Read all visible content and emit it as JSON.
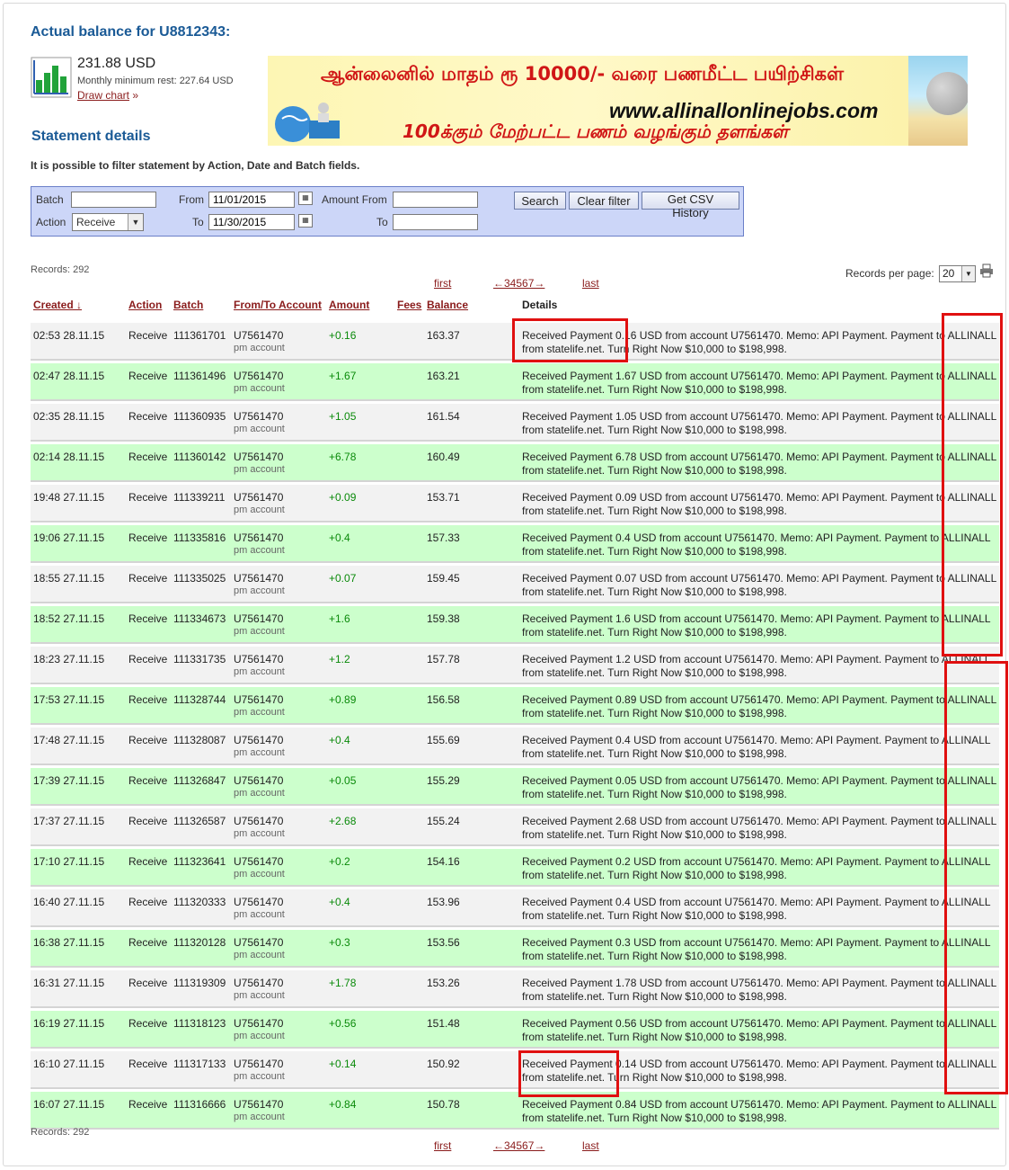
{
  "header": {
    "title": "Actual balance for U8812343:",
    "balance": "231.88 USD",
    "monthly_min": "Monthly minimum rest: 227.64 USD",
    "draw_chart": "Draw chart",
    "draw_chart_suffix": "»"
  },
  "banner": {
    "line1": "ஆன்லைனில் மாதம் ரூ 10000/- வரை பணமீட்ட பயிற்சிகள்",
    "line2": "www.allinallonlinejobs.com",
    "line3": "100க்கும் மேற்பட்ட பணம் வழங்கும் தளங்கள்"
  },
  "statement": {
    "title": "Statement details",
    "note": "It is possible to filter statement by Action, Date and Batch fields."
  },
  "filter": {
    "batch_label": "Batch",
    "action_label": "Action",
    "action_value": "Receive",
    "from_label": "From",
    "from_value": "11/01/2015",
    "to_label": "To",
    "to_value": "11/30/2015",
    "amount_from_label": "Amount From",
    "amount_to_label": "To",
    "search_btn": "Search",
    "clear_btn": "Clear filter",
    "csv_btn": "Get CSV History"
  },
  "records_label": "Records: 292",
  "pager": {
    "first": "first",
    "pages": "←34567→",
    "last": "last"
  },
  "records_per_page": {
    "label": "Records per page:",
    "value": "20"
  },
  "columns": {
    "created": "Created ↓",
    "action": "Action",
    "batch": "Batch",
    "account": "From/To Account",
    "amount": "Amount",
    "fees": "Fees",
    "balance": "Balance",
    "details": "Details"
  },
  "rows": [
    {
      "created": "02:53 28.11.15",
      "action": "Receive",
      "batch": "111361701",
      "account": "U7561470",
      "acct_type": "pm account",
      "amount": "+0.16",
      "balance": "163.37",
      "d1": "Received Payment 0.16 USD from account U7561470. Memo: API Payment. Payment to ALLINALL",
      "d2": "from statelife.net. Turn Right Now $10,000 to $198,998."
    },
    {
      "created": "02:47 28.11.15",
      "action": "Receive",
      "batch": "111361496",
      "account": "U7561470",
      "acct_type": "pm account",
      "amount": "+1.67",
      "balance": "163.21",
      "d1": "Received Payment 1.67 USD from account U7561470. Memo: API Payment. Payment to ALLINALL",
      "d2": "from statelife.net. Turn Right Now $10,000 to $198,998."
    },
    {
      "created": "02:35 28.11.15",
      "action": "Receive",
      "batch": "111360935",
      "account": "U7561470",
      "acct_type": "pm account",
      "amount": "+1.05",
      "balance": "161.54",
      "d1": "Received Payment 1.05 USD from account U7561470. Memo: API Payment. Payment to ALLINALL",
      "d2": "from statelife.net. Turn Right Now $10,000 to $198,998."
    },
    {
      "created": "02:14 28.11.15",
      "action": "Receive",
      "batch": "111360142",
      "account": "U7561470",
      "acct_type": "pm account",
      "amount": "+6.78",
      "balance": "160.49",
      "d1": "Received Payment 6.78 USD from account U7561470. Memo: API Payment. Payment to ALLINALL",
      "d2": "from statelife.net. Turn Right Now $10,000 to $198,998."
    },
    {
      "created": "19:48 27.11.15",
      "action": "Receive",
      "batch": "111339211",
      "account": "U7561470",
      "acct_type": "pm account",
      "amount": "+0.09",
      "balance": "153.71",
      "d1": "Received Payment 0.09 USD from account U7561470. Memo: API Payment. Payment to ALLINALL",
      "d2": "from statelife.net. Turn Right Now $10,000 to $198,998."
    },
    {
      "created": "19:06 27.11.15",
      "action": "Receive",
      "batch": "111335816",
      "account": "U7561470",
      "acct_type": "pm account",
      "amount": "+0.4",
      "balance": "157.33",
      "d1": "Received Payment 0.4 USD from account U7561470. Memo: API Payment. Payment to ALLINALL",
      "d2": "from statelife.net. Turn Right Now $10,000 to $198,998."
    },
    {
      "created": "18:55 27.11.15",
      "action": "Receive",
      "batch": "111335025",
      "account": "U7561470",
      "acct_type": "pm account",
      "amount": "+0.07",
      "balance": "159.45",
      "d1": "Received Payment 0.07 USD from account U7561470. Memo: API Payment. Payment to ALLINALL",
      "d2": "from statelife.net. Turn Right Now $10,000 to $198,998."
    },
    {
      "created": "18:52 27.11.15",
      "action": "Receive",
      "batch": "111334673",
      "account": "U7561470",
      "acct_type": "pm account",
      "amount": "+1.6",
      "balance": "159.38",
      "d1": "Received Payment 1.6 USD from account U7561470. Memo: API Payment. Payment to ALLINALL",
      "d2": "from statelife.net. Turn Right Now $10,000 to $198,998."
    },
    {
      "created": "18:23 27.11.15",
      "action": "Receive",
      "batch": "111331735",
      "account": "U7561470",
      "acct_type": "pm account",
      "amount": "+1.2",
      "balance": "157.78",
      "d1": "Received Payment 1.2 USD from account U7561470. Memo: API Payment. Payment to ALLINALL",
      "d2": "from statelife.net. Turn Right Now $10,000 to $198,998."
    },
    {
      "created": "17:53 27.11.15",
      "action": "Receive",
      "batch": "111328744",
      "account": "U7561470",
      "acct_type": "pm account",
      "amount": "+0.89",
      "balance": "156.58",
      "d1": "Received Payment 0.89 USD from account U7561470. Memo: API Payment. Payment to ALLINALL",
      "d2": "from statelife.net. Turn Right Now $10,000 to $198,998."
    },
    {
      "created": "17:48 27.11.15",
      "action": "Receive",
      "batch": "111328087",
      "account": "U7561470",
      "acct_type": "pm account",
      "amount": "+0.4",
      "balance": "155.69",
      "d1": "Received Payment 0.4 USD from account U7561470. Memo: API Payment. Payment to ALLINALL",
      "d2": "from statelife.net. Turn Right Now $10,000 to $198,998."
    },
    {
      "created": "17:39 27.11.15",
      "action": "Receive",
      "batch": "111326847",
      "account": "U7561470",
      "acct_type": "pm account",
      "amount": "+0.05",
      "balance": "155.29",
      "d1": "Received Payment 0.05 USD from account U7561470. Memo: API Payment. Payment to ALLINALL",
      "d2": "from statelife.net. Turn Right Now $10,000 to $198,998."
    },
    {
      "created": "17:37 27.11.15",
      "action": "Receive",
      "batch": "111326587",
      "account": "U7561470",
      "acct_type": "pm account",
      "amount": "+2.68",
      "balance": "155.24",
      "d1": "Received Payment 2.68 USD from account U7561470. Memo: API Payment. Payment to ALLINALL",
      "d2": "from statelife.net. Turn Right Now $10,000 to $198,998."
    },
    {
      "created": "17:10 27.11.15",
      "action": "Receive",
      "batch": "111323641",
      "account": "U7561470",
      "acct_type": "pm account",
      "amount": "+0.2",
      "balance": "154.16",
      "d1": "Received Payment 0.2 USD from account U7561470. Memo: API Payment. Payment to ALLINALL",
      "d2": "from statelife.net. Turn Right Now $10,000 to $198,998."
    },
    {
      "created": "16:40 27.11.15",
      "action": "Receive",
      "batch": "111320333",
      "account": "U7561470",
      "acct_type": "pm account",
      "amount": "+0.4",
      "balance": "153.96",
      "d1": "Received Payment 0.4 USD from account U7561470. Memo: API Payment. Payment to ALLINALL",
      "d2": "from statelife.net. Turn Right Now $10,000 to $198,998."
    },
    {
      "created": "16:38 27.11.15",
      "action": "Receive",
      "batch": "111320128",
      "account": "U7561470",
      "acct_type": "pm account",
      "amount": "+0.3",
      "balance": "153.56",
      "d1": "Received Payment 0.3 USD from account U7561470. Memo: API Payment. Payment to ALLINALL",
      "d2": "from statelife.net. Turn Right Now $10,000 to $198,998."
    },
    {
      "created": "16:31 27.11.15",
      "action": "Receive",
      "batch": "111319309",
      "account": "U7561470",
      "acct_type": "pm account",
      "amount": "+1.78",
      "balance": "153.26",
      "d1": "Received Payment 1.78 USD from account U7561470. Memo: API Payment. Payment to ALLINALL",
      "d2": "from statelife.net. Turn Right Now $10,000 to $198,998."
    },
    {
      "created": "16:19 27.11.15",
      "action": "Receive",
      "batch": "111318123",
      "account": "U7561470",
      "acct_type": "pm account",
      "amount": "+0.56",
      "balance": "151.48",
      "d1": "Received Payment 0.56 USD from account U7561470. Memo: API Payment. Payment to ALLINALL",
      "d2": "from statelife.net. Turn Right Now $10,000 to $198,998."
    },
    {
      "created": "16:10 27.11.15",
      "action": "Receive",
      "batch": "111317133",
      "account": "U7561470",
      "acct_type": "pm account",
      "amount": "+0.14",
      "balance": "150.92",
      "d1": "Received Payment 0.14 USD from account U7561470. Memo: API Payment. Payment to ALLINALL",
      "d2": "from statelife.net. Turn Right Now $10,000 to $198,998."
    },
    {
      "created": "16:07 27.11.15",
      "action": "Receive",
      "batch": "111316666",
      "account": "U7561470",
      "acct_type": "pm account",
      "amount": "+0.84",
      "balance": "150.78",
      "d1": "Received Payment 0.84 USD from account U7561470. Memo: API Payment. Payment to ALLINALL",
      "d2": "from statelife.net. Turn Right Now $10,000 to $198,998."
    }
  ],
  "colors": {
    "accent_blue": "#1a5a96",
    "link_red": "#8a1c1c",
    "row_green": "#ccffcc",
    "row_gray": "#f2f2f2",
    "amount_green": "#0a8a0a",
    "highlight_red": "#e01010",
    "filter_bg": "#ccd6f8"
  },
  "icons": [
    "bar-chart-icon",
    "calendar-icon",
    "dropdown-arrow-icon",
    "printer-icon"
  ]
}
